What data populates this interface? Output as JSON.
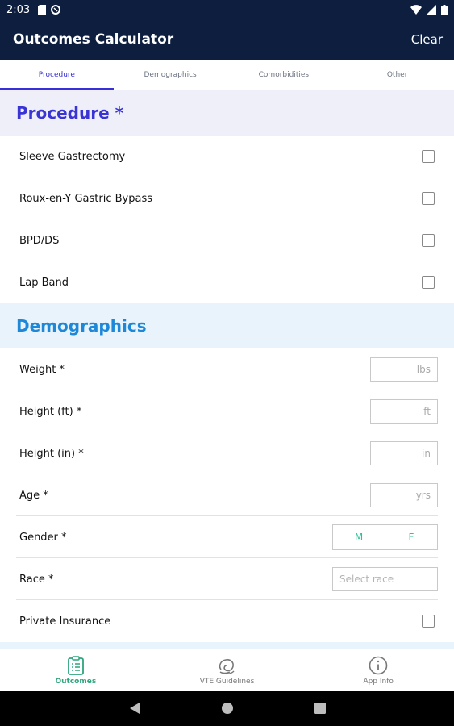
{
  "status_bar": {
    "time": "2:03",
    "icons": [
      "sd-card-icon",
      "sync-icon",
      "wifi-icon",
      "signal-icon",
      "battery-icon"
    ]
  },
  "app_bar": {
    "title": "Outcomes Calculator",
    "clear_label": "Clear"
  },
  "tabs": [
    {
      "label": "Procedure",
      "active": true
    },
    {
      "label": "Demographics",
      "active": false
    },
    {
      "label": "Comorbidities",
      "active": false
    },
    {
      "label": "Other",
      "active": false
    }
  ],
  "procedure_section": {
    "title": "Procedure *",
    "items": [
      {
        "label": "Sleeve Gastrectomy",
        "checked": false
      },
      {
        "label": "Roux-en-Y Gastric Bypass",
        "checked": false
      },
      {
        "label": "BPD/DS",
        "checked": false
      },
      {
        "label": "Lap Band",
        "checked": false
      }
    ]
  },
  "demographics_section": {
    "title": "Demographics",
    "weight": {
      "label": "Weight *",
      "placeholder": "lbs"
    },
    "height_ft": {
      "label": "Height (ft) *",
      "placeholder": "ft"
    },
    "height_in": {
      "label": "Height (in) *",
      "placeholder": "in"
    },
    "age": {
      "label": "Age *",
      "placeholder": "yrs"
    },
    "gender": {
      "label": "Gender *",
      "options": [
        "M",
        "F"
      ]
    },
    "race": {
      "label": "Race *",
      "placeholder": "Select race"
    },
    "private_insurance": {
      "label": "Private Insurance",
      "checked": false
    }
  },
  "bottom_nav": [
    {
      "label": "Outcomes",
      "icon": "clipboard-icon",
      "active": true
    },
    {
      "label": "VTE Guidelines",
      "icon": "vte-icon",
      "active": false
    },
    {
      "label": "App Info",
      "icon": "info-icon",
      "active": false
    }
  ],
  "colors": {
    "app_bar": "#0d1e3f",
    "accent_procedure": "#3a34d4",
    "accent_demographics": "#1e88d8",
    "accent_active_nav": "#2ea57a"
  }
}
